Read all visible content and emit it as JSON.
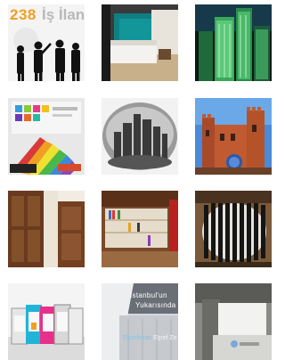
{
  "gallery": {
    "tiles": [
      {
        "id": "tile-1",
        "overlay": {
          "count": "238",
          "word": "İş İlan"
        }
      },
      {
        "id": "tile-2"
      },
      {
        "id": "tile-3"
      },
      {
        "id": "tile-4"
      },
      {
        "id": "tile-5"
      },
      {
        "id": "tile-6"
      },
      {
        "id": "tile-7"
      },
      {
        "id": "tile-8"
      },
      {
        "id": "tile-9"
      },
      {
        "id": "tile-10"
      },
      {
        "id": "tile-11",
        "overlay": {
          "line1": "İstanbul'un",
          "line2": "Yukarısında",
          "line3_hl": "Eşimlekan",
          "line3": "Eşref Ze"
        }
      },
      {
        "id": "tile-12"
      }
    ]
  }
}
